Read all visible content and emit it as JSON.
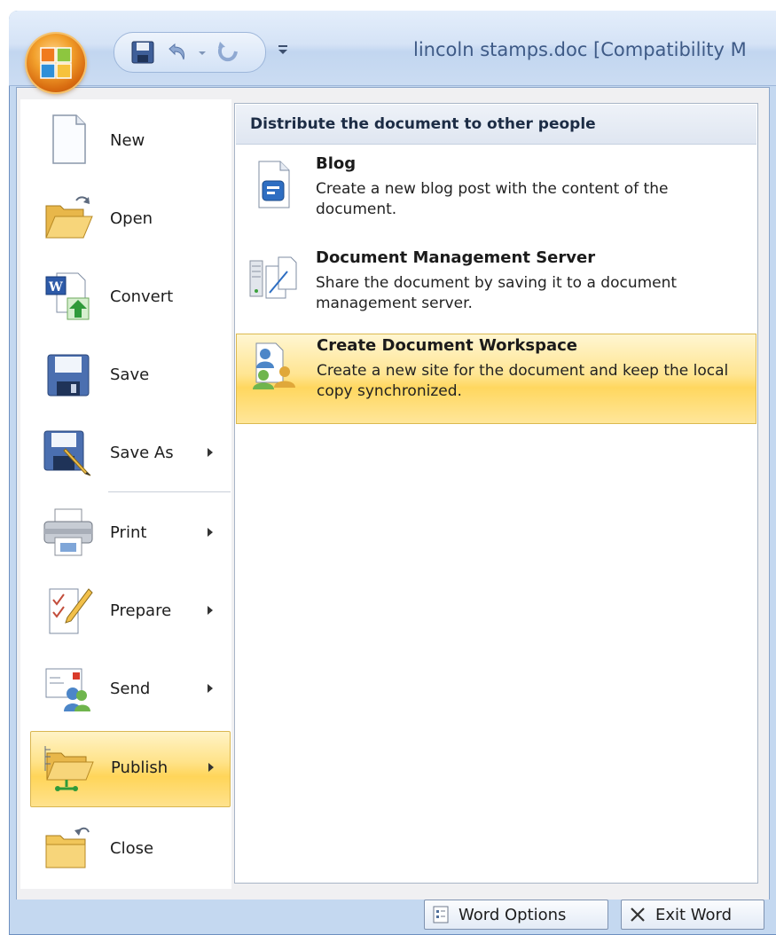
{
  "window": {
    "title": "lincoln stamps.doc [Compatibility M"
  },
  "quick_access_toolbar": {
    "icons": [
      "save-icon",
      "undo-icon",
      "undo-dropdown-icon",
      "redo-icon",
      "customize-qat-icon"
    ]
  },
  "office_menu": {
    "items": [
      {
        "label": "New",
        "icon": "new-document-icon",
        "has_submenu": false
      },
      {
        "label": "Open",
        "icon": "open-folder-icon",
        "has_submenu": false
      },
      {
        "label": "Convert",
        "icon": "convert-icon",
        "has_submenu": false
      },
      {
        "label": "Save",
        "icon": "save-icon",
        "has_submenu": false
      },
      {
        "label": "Save As",
        "icon": "save-as-icon",
        "has_submenu": true
      },
      {
        "label": "Print",
        "icon": "printer-icon",
        "has_submenu": true
      },
      {
        "label": "Prepare",
        "icon": "prepare-icon",
        "has_submenu": true
      },
      {
        "label": "Send",
        "icon": "send-icon",
        "has_submenu": true
      },
      {
        "label": "Publish",
        "icon": "publish-icon",
        "has_submenu": true,
        "active": true
      },
      {
        "label": "Close",
        "icon": "close-folder-icon",
        "has_submenu": false
      }
    ]
  },
  "submenu": {
    "header": "Distribute the document to other people",
    "items": [
      {
        "title": "Blog",
        "description": "Create a new blog post with the content of the document.",
        "icon": "blog-icon"
      },
      {
        "title": "Document Management Server",
        "description": "Share the document by saving it to a document management server.",
        "icon": "document-management-server-icon"
      },
      {
        "title": "Create Document Workspace",
        "description": "Create a new site for the document and keep the local copy synchronized.",
        "icon": "document-workspace-icon",
        "active": true
      }
    ]
  },
  "footer": {
    "word_options_label": "Word Options",
    "exit_word_label": "Exit Word"
  },
  "colors": {
    "highlight": "#ffd559",
    "window_frame": "#c4d8f0",
    "office_button": "#f2a02c"
  }
}
